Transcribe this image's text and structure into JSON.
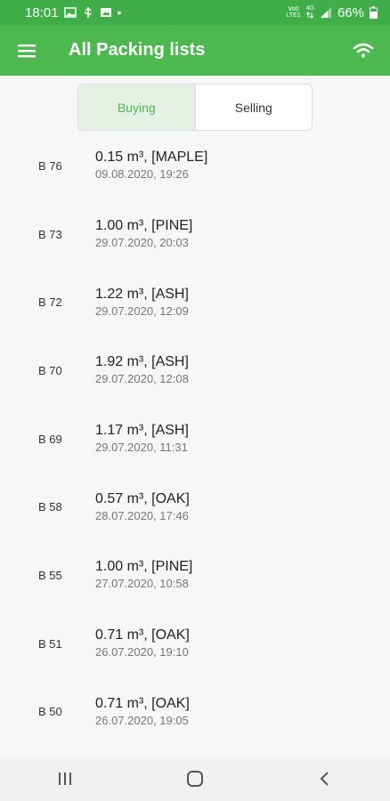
{
  "status_bar": {
    "time": "18:01",
    "dot": "•",
    "volte_top": "Vo0",
    "volte_bottom": "LTE1",
    "net_top": "4G",
    "battery": "66%"
  },
  "app_bar": {
    "title": "All Packing lists"
  },
  "tabs": {
    "buying": "Buying",
    "selling": "Selling"
  },
  "items": [
    {
      "code": "B 76",
      "main": "0.15 m³, [MAPLE]",
      "date": "09.08.2020, 19:26"
    },
    {
      "code": "B 73",
      "main": "1.00 m³, [PINE]",
      "date": "29.07.2020, 20:03"
    },
    {
      "code": "B 72",
      "main": "1.22 m³, [ASH]",
      "date": "29.07.2020, 12:09"
    },
    {
      "code": "B 70",
      "main": "1.92 m³, [ASH]",
      "date": "29.07.2020, 12:08"
    },
    {
      "code": "B 69",
      "main": "1.17 m³, [ASH]",
      "date": "29.07.2020, 11:31"
    },
    {
      "code": "B 58",
      "main": "0.57 m³, [OAK]",
      "date": "28.07.2020, 17:46"
    },
    {
      "code": "B 55",
      "main": "1.00 m³, [PINE]",
      "date": "27.07.2020, 10:58"
    },
    {
      "code": "B 51",
      "main": "0.71 m³, [OAK]",
      "date": "26.07.2020, 19:10"
    },
    {
      "code": "B 50",
      "main": "0.71 m³, [OAK]",
      "date": "26.07.2020, 19:05"
    }
  ],
  "colors": {
    "status_bar": "#3fae49",
    "app_bar": "#4cb84f",
    "accent": "#4cb84f"
  },
  "icons": {
    "menu": "hamburger-menu-icon",
    "wifi": "wifi-icon",
    "nav_recent": "recent-apps-icon",
    "nav_home": "home-icon",
    "nav_back": "back-icon"
  }
}
